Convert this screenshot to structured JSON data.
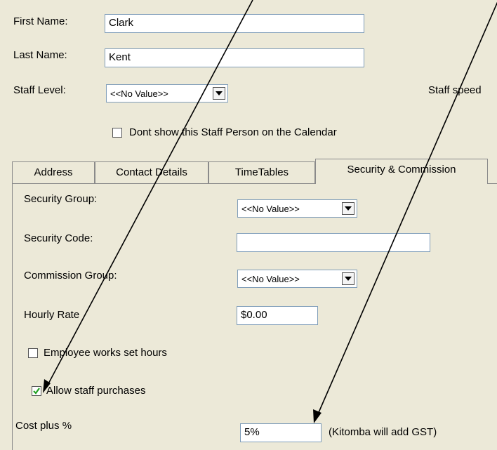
{
  "form": {
    "first_name_label": "First Name:",
    "first_name_value": "Clark",
    "last_name_label": "Last Name:",
    "last_name_value": "Kent",
    "staff_level_label": "Staff Level:",
    "staff_level_value": "<<No Value>>",
    "staff_speed_label": "Staff speed",
    "calendar_checkbox_label": "Dont show this Staff Person on the Calendar",
    "calendar_checkbox_checked": false
  },
  "tabs": [
    {
      "label": "Address",
      "active": false
    },
    {
      "label": "Contact Details",
      "active": false
    },
    {
      "label": "TimeTables",
      "active": false
    },
    {
      "label": "Security & Commission",
      "active": true
    }
  ],
  "security": {
    "security_group_label": "Security Group:",
    "security_group_value": "<<No Value>>",
    "security_code_label": "Security Code:",
    "security_code_value": "",
    "commission_group_label": "Commission Group:",
    "commission_group_value": "<<No Value>>",
    "hourly_rate_label": "Hourly Rate",
    "hourly_rate_value": "$0.00",
    "set_hours_label": "Employee works set hours",
    "set_hours_checked": false,
    "allow_purchases_label": "Allow staff purchases",
    "allow_purchases_checked": true,
    "cost_plus_label": "Cost plus %",
    "cost_plus_value": "5%",
    "gst_note": "(Kitomba will add GST)"
  },
  "icons": {
    "dropdown_arrow": "chevron-down-icon",
    "checkmark": "checkmark-icon",
    "annotation_arrow": "arrow-icon"
  },
  "colors": {
    "background": "#ece9d8",
    "field_border": "#7f9db9",
    "checkmark": "#21a121"
  }
}
